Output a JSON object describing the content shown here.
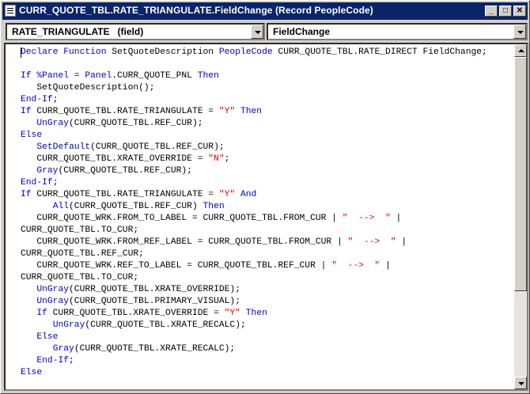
{
  "window": {
    "title": "CURR_QUOTE_TBL.RATE_TRIANGULATE.FieldChange (Record PeopleCode)",
    "controls": {
      "minimize": "_",
      "maximize": "□",
      "close": "✕"
    }
  },
  "toolbar": {
    "field_select": "RATE_TRIANGULATE   (field)",
    "event_select": "FieldChange"
  },
  "code": {
    "lines": [
      [
        [
          "kw",
          "Declare Function"
        ],
        [
          "t",
          " SetQuoteDescription "
        ],
        [
          "kw",
          "PeopleCode"
        ],
        [
          "t",
          " CURR_QUOTE_TBL.RATE_DIRECT FieldChange;"
        ]
      ],
      [],
      [
        [
          "kw",
          "If %Panel"
        ],
        [
          "t",
          " = "
        ],
        [
          "kw",
          "Panel"
        ],
        [
          "t",
          ".CURR_QUOTE_PNL "
        ],
        [
          "kw",
          "Then"
        ]
      ],
      [
        [
          "t",
          "   SetQuoteDescription();"
        ]
      ],
      [
        [
          "kw",
          "End-If"
        ],
        [
          "t",
          ";"
        ]
      ],
      [
        [
          "kw",
          "If"
        ],
        [
          "t",
          " CURR_QUOTE_TBL.RATE_TRIANGULATE = "
        ],
        [
          "str",
          "\"Y\""
        ],
        [
          "t",
          " "
        ],
        [
          "kw",
          "Then"
        ]
      ],
      [
        [
          "t",
          "   "
        ],
        [
          "kw",
          "UnGray"
        ],
        [
          "t",
          "(CURR_QUOTE_TBL.REF_CUR);"
        ]
      ],
      [
        [
          "kw",
          "Else"
        ]
      ],
      [
        [
          "t",
          "   "
        ],
        [
          "kw",
          "SetDefault"
        ],
        [
          "t",
          "(CURR_QUOTE_TBL.REF_CUR);"
        ]
      ],
      [
        [
          "t",
          "   CURR_QUOTE_TBL.XRATE_OVERRIDE = "
        ],
        [
          "str",
          "\"N\""
        ],
        [
          "t",
          ";"
        ]
      ],
      [
        [
          "t",
          "   "
        ],
        [
          "kw",
          "Gray"
        ],
        [
          "t",
          "(CURR_QUOTE_TBL.REF_CUR);"
        ]
      ],
      [
        [
          "kw",
          "End-If"
        ],
        [
          "t",
          ";"
        ]
      ],
      [
        [
          "kw",
          "If"
        ],
        [
          "t",
          " CURR_QUOTE_TBL.RATE_TRIANGULATE = "
        ],
        [
          "str",
          "\"Y\""
        ],
        [
          "t",
          " "
        ],
        [
          "kw",
          "And"
        ]
      ],
      [
        [
          "t",
          "      "
        ],
        [
          "kw",
          "All"
        ],
        [
          "t",
          "(CURR_QUOTE_TBL.REF_CUR) "
        ],
        [
          "kw",
          "Then"
        ]
      ],
      [
        [
          "t",
          "   CURR_QUOTE_WRK.FROM_TO_LABEL = CURR_QUOTE_TBL.FROM_CUR | "
        ],
        [
          "str",
          "\"  -->  \""
        ],
        [
          "t",
          " |"
        ]
      ],
      [
        [
          "t",
          "CURR_QUOTE_TBL.TO_CUR;"
        ]
      ],
      [
        [
          "t",
          "   CURR_QUOTE_WRK.FROM_REF_LABEL = CURR_QUOTE_TBL.FROM_CUR | "
        ],
        [
          "str",
          "\"  -->  \""
        ],
        [
          "t",
          " |"
        ]
      ],
      [
        [
          "t",
          "CURR_QUOTE_TBL.REF_CUR;"
        ]
      ],
      [
        [
          "t",
          "   CURR_QUOTE_WRK.REF_TO_LABEL = CURR_QUOTE_TBL.REF_CUR | "
        ],
        [
          "str",
          "\"  -->  \""
        ],
        [
          "t",
          " |"
        ]
      ],
      [
        [
          "t",
          "CURR_QUOTE_TBL.TO_CUR;"
        ]
      ],
      [
        [
          "t",
          "   "
        ],
        [
          "kw",
          "UnGray"
        ],
        [
          "t",
          "(CURR_QUOTE_TBL.XRATE_OVERRIDE);"
        ]
      ],
      [
        [
          "t",
          "   "
        ],
        [
          "kw",
          "UnGray"
        ],
        [
          "t",
          "(CURR_QUOTE_TBL.PRIMARY_VISUAL);"
        ]
      ],
      [
        [
          "t",
          "   "
        ],
        [
          "kw",
          "If"
        ],
        [
          "t",
          " CURR_QUOTE_TBL.XRATE_OVERRIDE = "
        ],
        [
          "str",
          "\"Y\""
        ],
        [
          "t",
          " "
        ],
        [
          "kw",
          "Then"
        ]
      ],
      [
        [
          "t",
          "      "
        ],
        [
          "kw",
          "UnGray"
        ],
        [
          "t",
          "(CURR_QUOTE_TBL.XRATE_RECALC);"
        ]
      ],
      [
        [
          "t",
          "   "
        ],
        [
          "kw",
          "Else"
        ]
      ],
      [
        [
          "t",
          "      "
        ],
        [
          "kw",
          "Gray"
        ],
        [
          "t",
          "(CURR_QUOTE_TBL.XRATE_RECALC);"
        ]
      ],
      [
        [
          "t",
          "   "
        ],
        [
          "kw",
          "End-If"
        ],
        [
          "t",
          ";"
        ]
      ],
      [
        [
          "kw",
          "Else"
        ]
      ]
    ]
  },
  "colors": {
    "keyword": "#0000cc",
    "string": "#e00000",
    "title_bar": "#0a246a"
  }
}
